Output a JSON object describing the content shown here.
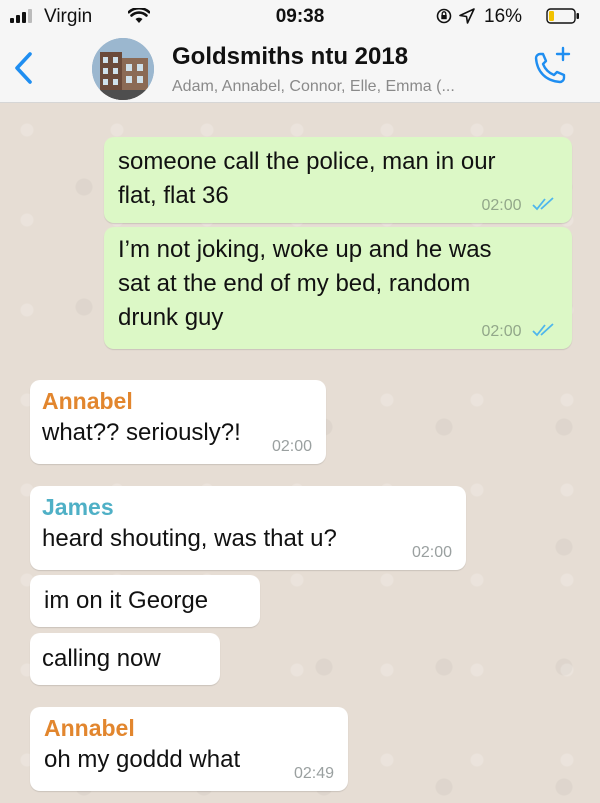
{
  "status_bar": {
    "carrier": "Virgin",
    "time": "09:38",
    "battery_percent": "16%"
  },
  "header": {
    "title": "Goldsmiths ntu 2018",
    "subtitle": "Adam, Annabel, Connor, Elle, Emma (..."
  },
  "colors": {
    "accent": "#1f8ef1",
    "outgoing_bubble": "#dcf8c6",
    "incoming_bubble": "#ffffff",
    "sender_annabel": "#e2862e",
    "sender_james": "#4fb0c6",
    "read_ticks": "#4fb6ec"
  },
  "messages": [
    {
      "direction": "out",
      "text_lines": [
        "someone call the police, man in our",
        "flat, flat 36"
      ],
      "time": "02:00",
      "read": true
    },
    {
      "direction": "out",
      "text_lines": [
        "I’m not joking, woke up and he was",
        "sat at the end of my bed, random",
        "drunk guy"
      ],
      "time": "02:00",
      "read": true
    },
    {
      "direction": "in",
      "sender": "Annabel",
      "text_lines": [
        "what?? seriously?!"
      ],
      "time": "02:00"
    },
    {
      "direction": "in",
      "sender": "James",
      "text_lines": [
        "heard shouting, was that u?"
      ],
      "time": "02:00"
    },
    {
      "direction": "in",
      "text_lines": [
        "im on it George"
      ]
    },
    {
      "direction": "in",
      "text_lines": [
        "calling now"
      ]
    },
    {
      "direction": "in",
      "sender": "Annabel",
      "text_lines": [
        "oh my goddd what"
      ],
      "time": "02:49"
    }
  ]
}
